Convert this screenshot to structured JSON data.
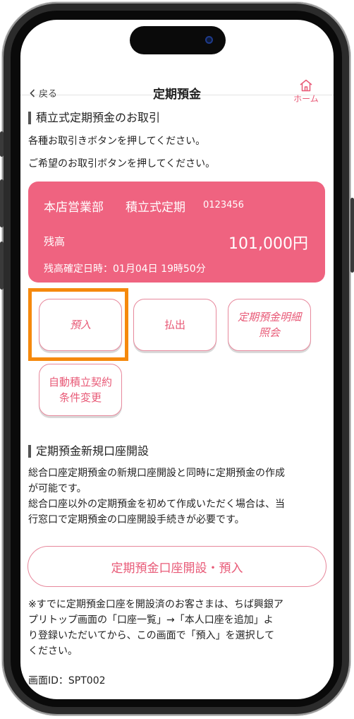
{
  "navbar": {
    "back_label": "戻る",
    "title": "定期預金",
    "home_label": "ホーム"
  },
  "section1": {
    "heading": "積立式定期預金のお取引",
    "line1": "各種お取引きボタンを押してください。",
    "line2": "ご希望のお取引ボタンを押してください。"
  },
  "account": {
    "branch": "本店営業部",
    "type": "積立式定期",
    "number": "0123456",
    "balance_label": "残高",
    "balance": "101,000円",
    "confirmed_at": "残高確定日時：01月04日 19時50分"
  },
  "actions": {
    "deposit": "預入",
    "withdraw": "払出",
    "statement_line1": "定期預金明細",
    "statement_line2": "照会",
    "auto_line1": "自動積立契約",
    "auto_line2": "条件変更"
  },
  "section2": {
    "heading": "定期預金新規口座開設",
    "line1": "総合口座定期預金の新規口座開設と同時に定期預金の作成",
    "line2": "が可能です。",
    "line3": "総合口座以外の定期預金を初めて作成いただく場合は、当",
    "line4": "行窓口で定期預金の口座開設手続きが必要です。"
  },
  "open_account_button": "定期預金口座開設・預入",
  "note": {
    "line1": "※すでに定期預金口座を開設済のお客さまは、ちば興銀ア",
    "line2": "プリトップ画面の「口座一覧」→「本人口座を追加」よ",
    "line3": "り登録いただいてから、この画面で「預入」を選択して",
    "line4": "ください。"
  },
  "screen_id": "画面ID：SPT002",
  "colors": {
    "accent": "#e85a77",
    "card": "#ef6380",
    "highlight": "#f5890d"
  }
}
